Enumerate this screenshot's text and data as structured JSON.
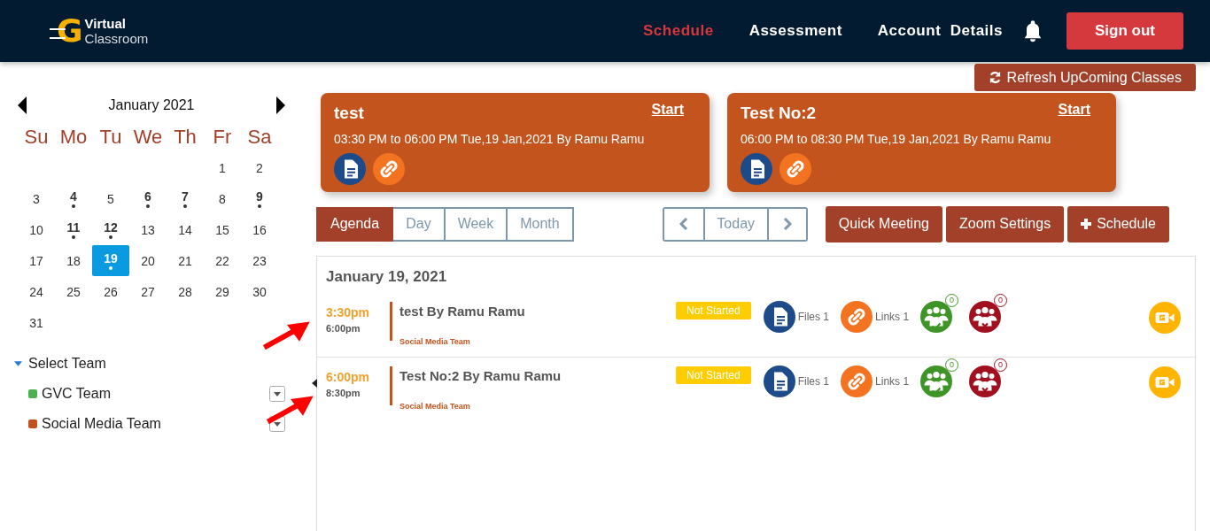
{
  "header": {
    "logo_letter": "G",
    "logo_line1": "Virtual",
    "logo_line2": "Classroom",
    "nav": [
      {
        "label": "Schedule",
        "selected": true
      },
      {
        "label": "Assessment",
        "selected": false
      },
      {
        "label": "Account  Details",
        "selected": false
      }
    ],
    "sign_out": "Sign out"
  },
  "sidebar": {
    "calendar": {
      "month": "January 2021",
      "weekdays": [
        "Su",
        "Mo",
        "Tu",
        "We",
        "Th",
        "Fr",
        "Sa"
      ],
      "weeks": [
        [
          {
            "kind": "blank"
          },
          {
            "kind": "blank"
          },
          {
            "kind": "blank"
          },
          {
            "kind": "blank"
          },
          {
            "kind": "blank"
          },
          {
            "kind": "day",
            "label": "1",
            "has_event": false,
            "selected": false
          },
          {
            "kind": "day",
            "label": "2",
            "has_event": false,
            "selected": false
          }
        ],
        [
          {
            "kind": "day",
            "label": "3",
            "has_event": false,
            "selected": false
          },
          {
            "kind": "day",
            "label": "4",
            "has_event": true,
            "selected": false
          },
          {
            "kind": "day",
            "label": "5",
            "has_event": false,
            "selected": false
          },
          {
            "kind": "day",
            "label": "6",
            "has_event": true,
            "selected": false
          },
          {
            "kind": "day",
            "label": "7",
            "has_event": true,
            "selected": false
          },
          {
            "kind": "day",
            "label": "8",
            "has_event": false,
            "selected": false
          },
          {
            "kind": "day",
            "label": "9",
            "has_event": true,
            "selected": false
          }
        ],
        [
          {
            "kind": "day",
            "label": "10",
            "has_event": false,
            "selected": false
          },
          {
            "kind": "day",
            "label": "11",
            "has_event": true,
            "selected": false
          },
          {
            "kind": "day",
            "label": "12",
            "has_event": true,
            "selected": false
          },
          {
            "kind": "day",
            "label": "13",
            "has_event": false,
            "selected": false
          },
          {
            "kind": "day",
            "label": "14",
            "has_event": false,
            "selected": false
          },
          {
            "kind": "day",
            "label": "15",
            "has_event": false,
            "selected": false
          },
          {
            "kind": "day",
            "label": "16",
            "has_event": false,
            "selected": false
          }
        ],
        [
          {
            "kind": "day",
            "label": "17",
            "has_event": false,
            "selected": false
          },
          {
            "kind": "day",
            "label": "18",
            "has_event": false,
            "selected": false
          },
          {
            "kind": "day",
            "label": "19",
            "has_event": true,
            "selected": true
          },
          {
            "kind": "day",
            "label": "20",
            "has_event": false,
            "selected": false
          },
          {
            "kind": "day",
            "label": "21",
            "has_event": false,
            "selected": false
          },
          {
            "kind": "day",
            "label": "22",
            "has_event": false,
            "selected": false
          },
          {
            "kind": "day",
            "label": "23",
            "has_event": false,
            "selected": false
          }
        ],
        [
          {
            "kind": "day",
            "label": "24",
            "has_event": false,
            "selected": false
          },
          {
            "kind": "day",
            "label": "25",
            "has_event": false,
            "selected": false
          },
          {
            "kind": "day",
            "label": "26",
            "has_event": false,
            "selected": false
          },
          {
            "kind": "day",
            "label": "27",
            "has_event": false,
            "selected": false
          },
          {
            "kind": "day",
            "label": "28",
            "has_event": false,
            "selected": false
          },
          {
            "kind": "day",
            "label": "29",
            "has_event": false,
            "selected": false
          },
          {
            "kind": "day",
            "label": "30",
            "has_event": false,
            "selected": false
          }
        ],
        [
          {
            "kind": "day",
            "label": "31",
            "has_event": false,
            "selected": false
          }
        ]
      ]
    },
    "team_heading": "Select Team",
    "expanded": true,
    "teams": [
      {
        "name": "GVC Team",
        "color": "#4caf50"
      },
      {
        "name": "Social Media Team",
        "color": "#c0531f"
      }
    ]
  },
  "refresh_button": "Refresh UpComing Classes",
  "upcoming": [
    {
      "title": "test",
      "start": "Start",
      "details": "03:30 PM to 06:00 PM Tue,19 Jan,2021 By Ramu Ramu"
    },
    {
      "title": "Test No:2",
      "start": "Start",
      "details": "06:00 PM to 08:30 PM Tue,19 Jan,2021 By Ramu Ramu"
    }
  ],
  "views": [
    {
      "label": "Agenda",
      "selected": true
    },
    {
      "label": "Day",
      "selected": false
    },
    {
      "label": "Week",
      "selected": false
    },
    {
      "label": "Month",
      "selected": false
    }
  ],
  "today": "Today",
  "actions": [
    {
      "label": "Quick Meeting",
      "kind": "plain"
    },
    {
      "label": "Zoom Settings",
      "kind": "plain"
    },
    {
      "label": "Schedule",
      "kind": "add"
    }
  ],
  "agenda": {
    "date": "January 19, 2021",
    "rows": [
      {
        "start": "3:30pm",
        "end": "6:00pm",
        "title": "test By Ramu Ramu",
        "team": "Social Media Team",
        "status": "Not Started",
        "files": "Files 1",
        "links": "Links 1",
        "accepted": "0",
        "declined": "0"
      },
      {
        "start": "6:00pm",
        "end": "8:30pm",
        "title": "Test No:2 By Ramu Ramu",
        "team": "Social Media Team",
        "status": "Not Started",
        "files": "Files 1",
        "links": "Links 1",
        "accepted": "0",
        "declined": "0"
      }
    ]
  }
}
